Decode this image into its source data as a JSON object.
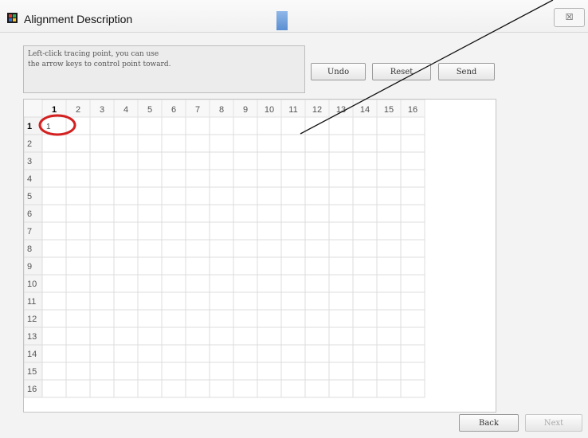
{
  "window": {
    "title": "Alignment Description",
    "close_label": "☒"
  },
  "instructions": "Left-click tracing point, you can use\nthe arrow keys to control point toward.",
  "buttons": {
    "undo": "Undo",
    "reset": "Reset",
    "send": "Send",
    "back": "Back",
    "next": "Next"
  },
  "grid": {
    "columns": [
      "1",
      "2",
      "3",
      "4",
      "5",
      "6",
      "7",
      "8",
      "9",
      "10",
      "11",
      "12",
      "13",
      "14",
      "15",
      "16"
    ],
    "rows": [
      "1",
      "2",
      "3",
      "4",
      "5",
      "6",
      "7",
      "8",
      "9",
      "10",
      "11",
      "12",
      "13",
      "14",
      "15",
      "16"
    ],
    "selected_column": "1",
    "selected_row": "1",
    "marked_cell": {
      "row": 1,
      "column": 1,
      "value": "1"
    }
  },
  "annotation": {
    "highlight_color": "#d42020"
  }
}
